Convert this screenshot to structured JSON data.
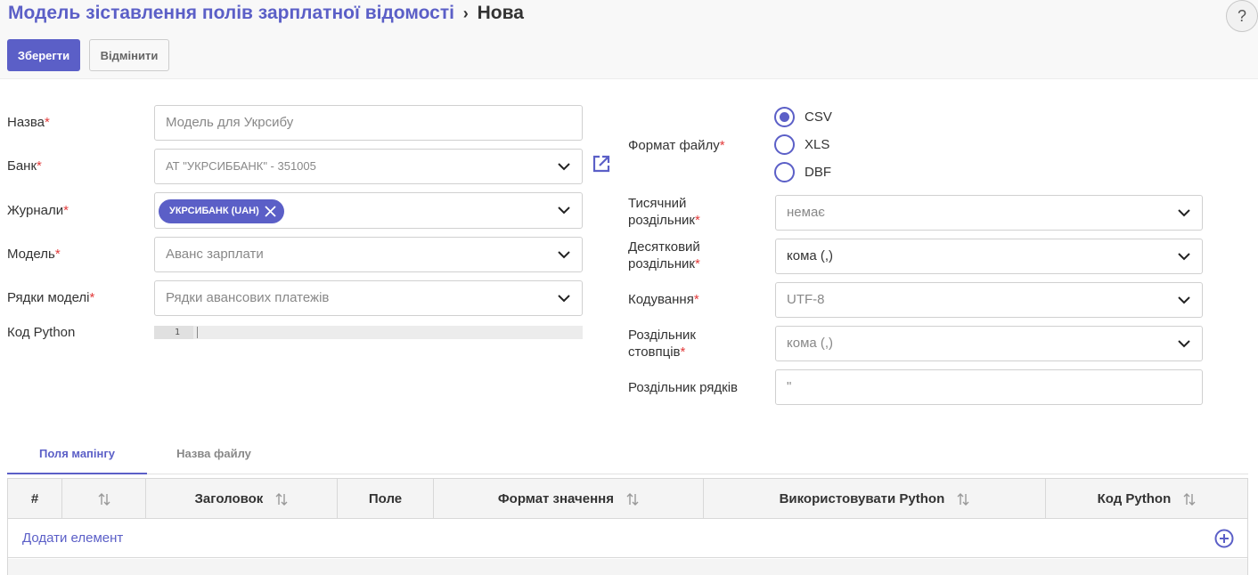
{
  "header": {
    "breadcrumb_parent": "Модель зіставлення полів зарплатної відомості",
    "breadcrumb_separator": "›",
    "breadcrumb_current": "Нова",
    "help_label": "?",
    "save_label": "Зберегти",
    "cancel_label": "Відмінити"
  },
  "form_left": {
    "name": {
      "label": "Назва",
      "placeholder": "Модель для Укрсибу"
    },
    "bank": {
      "label": "Банк",
      "value": "АТ \"УКРСИББАНК\" - 351005"
    },
    "journals": {
      "label": "Журнали",
      "chip": "УКРСИБАНК (UAH)"
    },
    "model": {
      "label": "Модель",
      "placeholder": "Аванс зарплати"
    },
    "model_rows": {
      "label": "Рядки моделі",
      "placeholder": "Рядки авансових платежів"
    },
    "python_code": {
      "label": "Код Python",
      "line_number": "1"
    }
  },
  "form_right": {
    "file_format": {
      "label": "Формат файлу",
      "options": [
        "CSV",
        "XLS",
        "DBF"
      ],
      "selected": "CSV"
    },
    "thousands_sep": {
      "label_line1": "Тисячний",
      "label_line2": "роздільник",
      "value": "немає"
    },
    "decimal_sep": {
      "label_line1": "Десятковий",
      "label_line2": "роздільник",
      "value": "кома (,)"
    },
    "encoding": {
      "label": "Кодування",
      "value": "UTF-8"
    },
    "column_sep": {
      "label_line1": "Роздільник",
      "label_line2": "стовпців",
      "value": "кома (,)"
    },
    "row_sep": {
      "label": "Роздільник рядків",
      "value": "\""
    }
  },
  "required_mark": "*",
  "tabs": [
    {
      "label": "Поля мапінгу",
      "active": true
    },
    {
      "label": "Назва файлу",
      "active": false
    }
  ],
  "table": {
    "columns": [
      "#",
      "",
      "Заголовок",
      "Поле",
      "Формат значення",
      "Використовувати Python",
      "Код Python"
    ],
    "add_label": "Додати елемент"
  },
  "colors": {
    "accent": "#5b5fc7",
    "required": "#e23b3b"
  }
}
